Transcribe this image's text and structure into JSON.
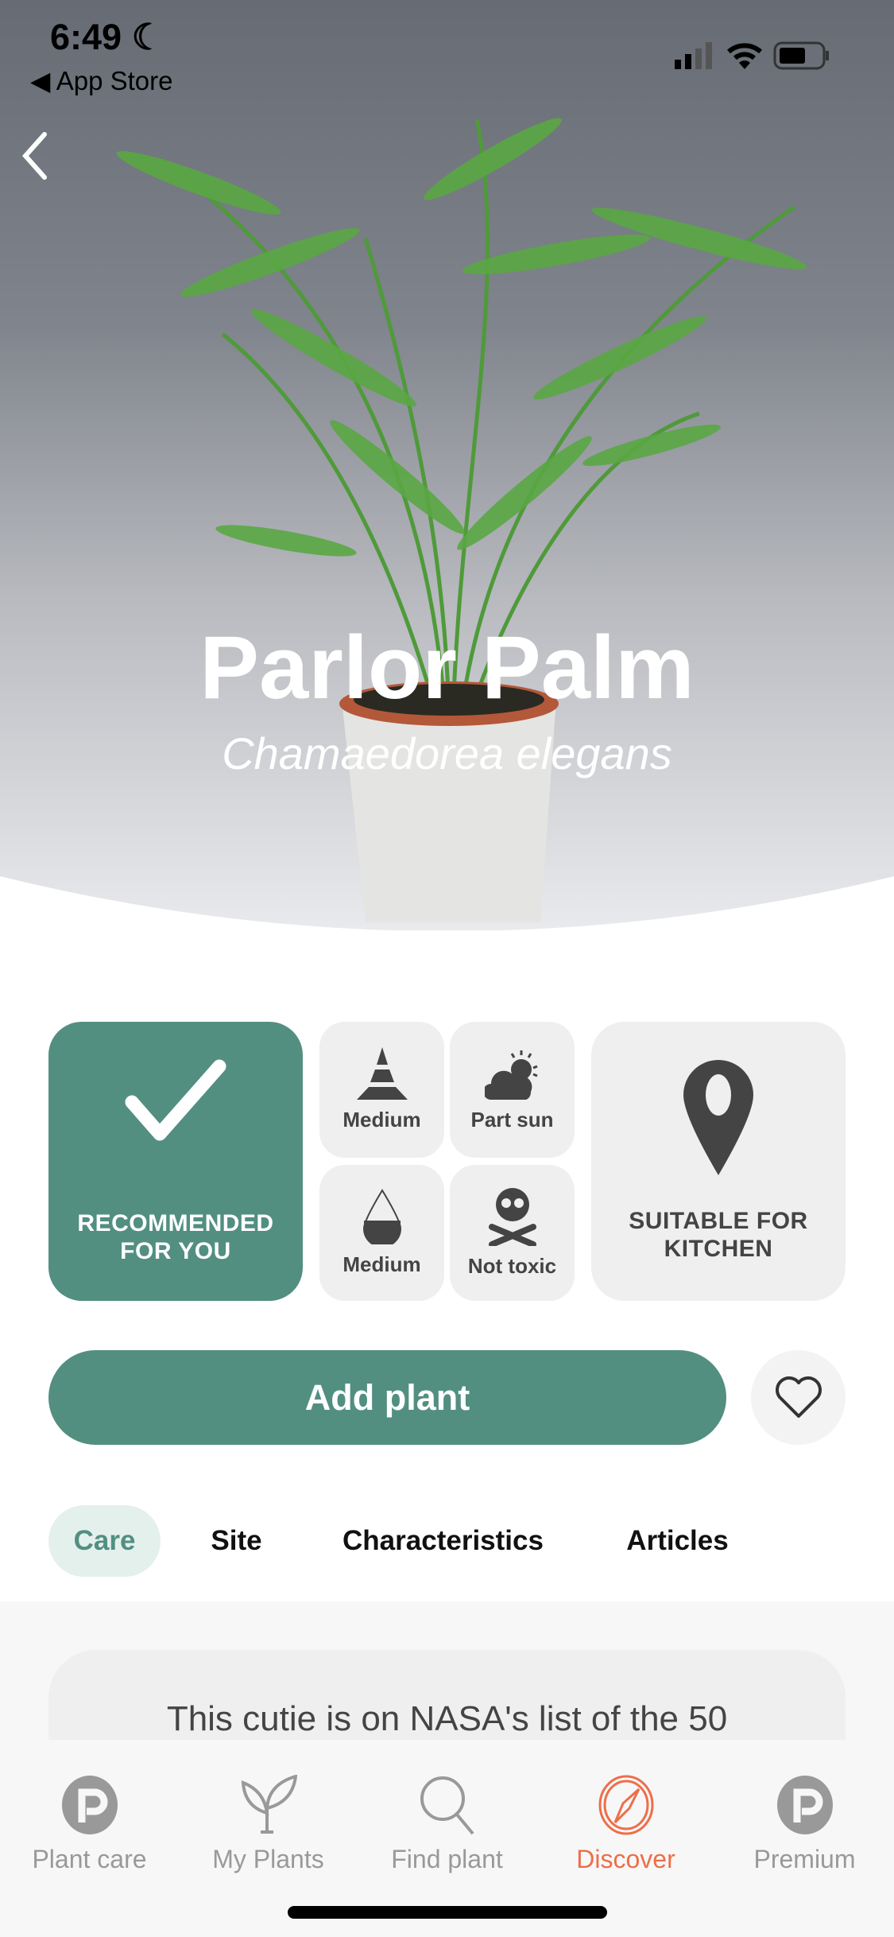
{
  "status_bar": {
    "time": "6:49",
    "back_app": "App Store"
  },
  "plant": {
    "name": "Parlor Palm",
    "scientific_name": "Chamaedorea elegans"
  },
  "badges": {
    "recommended": "RECOMMENDED FOR YOU",
    "care_level": "Medium",
    "light": "Part sun",
    "water": "Medium",
    "toxicity": "Not toxic",
    "location": "SUITABLE FOR KITCHEN"
  },
  "actions": {
    "add_plant": "Add plant"
  },
  "tabs": [
    {
      "label": "Care",
      "active": true
    },
    {
      "label": "Site"
    },
    {
      "label": "Characteristics"
    },
    {
      "label": "Articles"
    }
  ],
  "info_text": "This cutie is on NASA's list of the 50",
  "nav": [
    {
      "label": "Plant care",
      "icon": "planta-logo-icon"
    },
    {
      "label": "My Plants",
      "icon": "sprout-icon"
    },
    {
      "label": "Find plant",
      "icon": "search-icon"
    },
    {
      "label": "Discover",
      "icon": "compass-icon",
      "active": true
    },
    {
      "label": "Premium",
      "icon": "planta-logo-icon"
    }
  ],
  "colors": {
    "primary": "#528f80",
    "accent": "#ee6e49",
    "card": "#efefef"
  }
}
